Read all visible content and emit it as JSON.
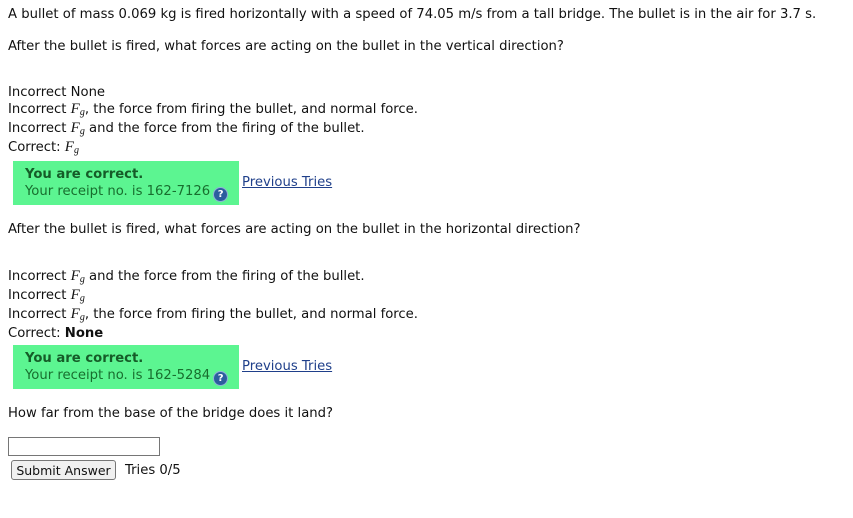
{
  "problem": {
    "statement": "A bullet of mass 0.069 kg is fired horizontally with a speed of 74.05 m/s from a tall bridge. The bullet is in the air for 3.7 s."
  },
  "part1": {
    "question": "After the bullet is fired, what forces are acting on the bullet in the vertical direction?",
    "attempts": [
      {
        "status": "Incorrect",
        "text": "None"
      },
      {
        "status": "Incorrect",
        "text": ", the force from firing the bullet, and normal force."
      },
      {
        "status": "Incorrect",
        "text": "and the force from the firing of the bullet."
      }
    ],
    "correct_label": "Correct:",
    "feedback": {
      "title": "You are correct.",
      "receipt": "Your receipt no. is 162-7126"
    },
    "previous_tries": "Previous Tries"
  },
  "part2": {
    "question": "After the bullet is fired, what forces are acting on the bullet in the horizontal direction?",
    "attempts": [
      {
        "status": "Incorrect",
        "text": "and the force from the firing of the bullet."
      },
      {
        "status": "Incorrect",
        "text": ""
      },
      {
        "status": "Incorrect",
        "text": ", the force from firing the bullet, and normal force."
      }
    ],
    "correct_label": "Correct:",
    "correct_value": "None",
    "feedback": {
      "title": "You are correct.",
      "receipt": "Your receipt no. is 162-5284"
    },
    "previous_tries": "Previous Tries"
  },
  "part3": {
    "question": "How far from the base of the bridge does it land?",
    "answer_value": "",
    "submit_label": "Submit Answer",
    "tries": "Tries 0/5"
  },
  "symbols": {
    "F": "F",
    "g": "g"
  },
  "icons": {
    "help": "help-icon"
  },
  "colors": {
    "correct_bg": "#5cf591",
    "link": "#1f3f8a",
    "help_icon": "#2c5e9e"
  }
}
